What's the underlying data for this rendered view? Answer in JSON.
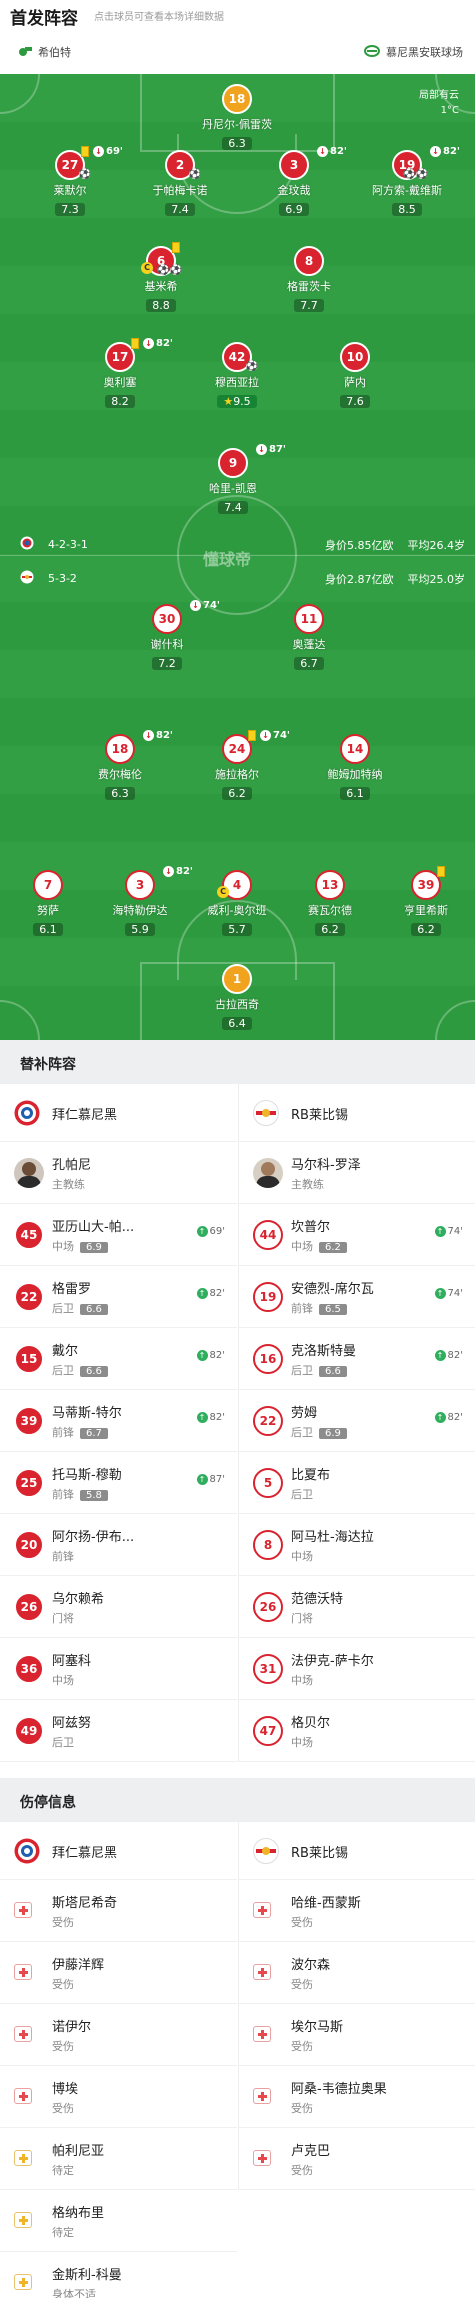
{
  "header": {
    "title": "首发阵容",
    "subtitle": "点击球员可查看本场详细数据"
  },
  "venue": {
    "left": "希伯特",
    "right": "慕尼黑安联球场"
  },
  "weather": {
    "line1": "局部有云",
    "line2": "1°C"
  },
  "watermark": "懂球帝",
  "home_info": {
    "formation": "4-2-3-1",
    "value": "身价5.85亿欧",
    "age": "平均26.4岁"
  },
  "away_info": {
    "formation": "5-3-2",
    "value": "身价2.87亿欧",
    "age": "平均25.0岁"
  },
  "home_players": [
    {
      "num": "18",
      "name": "丹尼尔-佩雷茨",
      "rating": "6.3",
      "style": "orange"
    },
    {
      "num": "27",
      "name": "莱默尔",
      "rating": "7.3",
      "style": "red",
      "yc": true,
      "sub": "69'",
      "ball": "⚽"
    },
    {
      "num": "2",
      "name": "于帕梅卡诺",
      "rating": "7.4",
      "style": "red",
      "ball": "⚽"
    },
    {
      "num": "3",
      "name": "金玟哉",
      "rating": "6.9",
      "style": "red",
      "sub": "82'"
    },
    {
      "num": "19",
      "name": "阿方索-戴维斯",
      "rating": "8.5",
      "style": "red",
      "sub": "82'",
      "ball": "⚽⚽"
    },
    {
      "num": "6",
      "name": "基米希",
      "rating": "8.8",
      "style": "red",
      "yc": true,
      "cap": "C",
      "ball": "⚽⚽"
    },
    {
      "num": "8",
      "name": "格雷茨卡",
      "rating": "7.7",
      "style": "red"
    },
    {
      "num": "17",
      "name": "奥利塞",
      "rating": "8.2",
      "style": "red",
      "yc": true,
      "sub": "82'"
    },
    {
      "num": "42",
      "name": "穆西亚拉",
      "rating": "9.5",
      "style": "red",
      "star": true,
      "ball": "⚽"
    },
    {
      "num": "10",
      "name": "萨内",
      "rating": "7.6",
      "style": "red"
    },
    {
      "num": "9",
      "name": "哈里-凯恩",
      "rating": "7.4",
      "style": "red",
      "sub": "87'"
    }
  ],
  "away_players": [
    {
      "num": "30",
      "name": "谢什科",
      "rating": "7.2",
      "style": "white",
      "sub": "74'"
    },
    {
      "num": "11",
      "name": "奥蓬达",
      "rating": "6.7",
      "style": "white"
    },
    {
      "num": "18",
      "name": "费尔梅伦",
      "rating": "6.3",
      "style": "white",
      "sub": "82'"
    },
    {
      "num": "24",
      "name": "施拉格尔",
      "rating": "6.2",
      "style": "white",
      "yc": true,
      "sub": "74'"
    },
    {
      "num": "14",
      "name": "鲍姆加特纳",
      "rating": "6.1",
      "style": "white"
    },
    {
      "num": "7",
      "name": "努萨",
      "rating": "6.1",
      "style": "white"
    },
    {
      "num": "3",
      "name": "海特勒伊达",
      "rating": "5.9",
      "style": "white",
      "sub": "82'"
    },
    {
      "num": "4",
      "name": "威利-奥尔班",
      "rating": "5.7",
      "style": "white",
      "cap": "C"
    },
    {
      "num": "13",
      "name": "赛瓦尔德",
      "rating": "6.2",
      "style": "white"
    },
    {
      "num": "39",
      "name": "亨里希斯",
      "rating": "6.2",
      "style": "white",
      "yc": true
    },
    {
      "num": "1",
      "name": "古拉西奇",
      "rating": "6.4",
      "style": "orange"
    }
  ],
  "subs": {
    "title": "替补阵容",
    "home_team": "拜仁慕尼黑",
    "away_team": "RB莱比锡",
    "home_coach": {
      "name": "孔帕尼",
      "role": "主教练"
    },
    "away_coach": {
      "name": "马尔科-罗泽",
      "role": "主教练"
    },
    "home": [
      {
        "num": "45",
        "name": "亚历山大-帕...",
        "pos": "中场",
        "rating": "6.9",
        "minute": "69'"
      },
      {
        "num": "22",
        "name": "格雷罗",
        "pos": "后卫",
        "rating": "6.6",
        "minute": "82'"
      },
      {
        "num": "15",
        "name": "戴尔",
        "pos": "后卫",
        "rating": "6.6",
        "minute": "82'"
      },
      {
        "num": "39",
        "name": "马蒂斯-特尔",
        "pos": "前锋",
        "rating": "6.7",
        "minute": "82'"
      },
      {
        "num": "25",
        "name": "托马斯-穆勒",
        "pos": "前锋",
        "rating": "5.8",
        "minute": "87'"
      },
      {
        "num": "20",
        "name": "阿尔扬-伊布...",
        "pos": "前锋"
      },
      {
        "num": "26",
        "name": "乌尔赖希",
        "pos": "门将"
      },
      {
        "num": "36",
        "name": "阿塞科",
        "pos": "中场"
      },
      {
        "num": "49",
        "name": "阿兹努",
        "pos": "后卫"
      }
    ],
    "away": [
      {
        "num": "44",
        "name": "坎普尔",
        "pos": "中场",
        "rating": "6.2",
        "minute": "74'"
      },
      {
        "num": "19",
        "name": "安德烈-席尔瓦",
        "pos": "前锋",
        "rating": "6.5",
        "minute": "74'"
      },
      {
        "num": "16",
        "name": "克洛斯特曼",
        "pos": "后卫",
        "rating": "6.6",
        "minute": "82'"
      },
      {
        "num": "22",
        "name": "劳姆",
        "pos": "后卫",
        "rating": "6.9",
        "minute": "82'"
      },
      {
        "num": "5",
        "name": "比夏布",
        "pos": "后卫"
      },
      {
        "num": "8",
        "name": "阿马杜-海达拉",
        "pos": "中场"
      },
      {
        "num": "26",
        "name": "范德沃特",
        "pos": "门将"
      },
      {
        "num": "31",
        "name": "法伊克-萨卡尔",
        "pos": "中场"
      },
      {
        "num": "47",
        "name": "格贝尔",
        "pos": "中场"
      }
    ]
  },
  "injuries": {
    "title": "伤停信息",
    "home_team": "拜仁慕尼黑",
    "away_team": "RB莱比锡",
    "home": [
      {
        "name": "斯塔尼希奇",
        "status": "受伤"
      },
      {
        "name": "伊藤洋辉",
        "status": "受伤"
      },
      {
        "name": "诺伊尔",
        "status": "受伤"
      },
      {
        "name": "博埃",
        "status": "受伤"
      },
      {
        "name": "帕利尼亚",
        "status": "待定"
      },
      {
        "name": "格纳布里",
        "status": "待定"
      },
      {
        "name": "金斯利-科曼",
        "status": "身体不适"
      }
    ],
    "away": [
      {
        "name": "哈维-西蒙斯",
        "status": "受伤"
      },
      {
        "name": "波尔森",
        "status": "受伤"
      },
      {
        "name": "埃尔马斯",
        "status": "受伤"
      },
      {
        "name": "阿桑-韦德拉奥果",
        "status": "受伤"
      },
      {
        "name": "卢克巴",
        "status": "受伤"
      }
    ]
  },
  "colors": {
    "pitch": "#2e9a3f",
    "home": "#d9232e",
    "gk": "#f2a31d",
    "sub_green": "#2fae5e"
  }
}
